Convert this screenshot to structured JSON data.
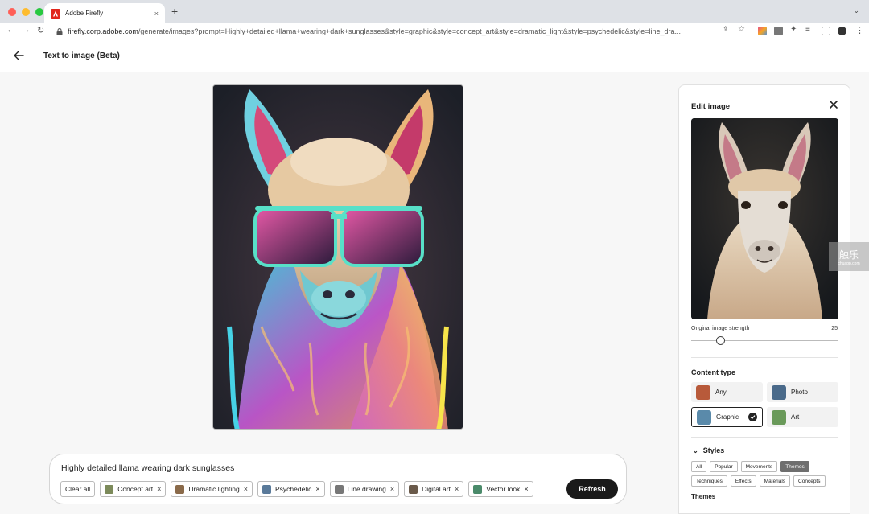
{
  "browser": {
    "tab_title": "Adobe Firefly",
    "url_host": "firefly.corp.adobe.com",
    "url_path": "/generate/images?prompt=Highly+detailed+llama+wearing+dark+sunglasses&style=graphic&style=concept_art&style=dramatic_light&style=psychedelic&style=line_dra...",
    "new_tab_label": "+",
    "close_tab_label": "×"
  },
  "header": {
    "title": "Text to image (Beta)"
  },
  "prompt": {
    "text": "Highly detailed llama wearing dark sunglasses",
    "clear_all": "Clear all",
    "chips": [
      {
        "label": "Concept art",
        "color": "#7c8a5a"
      },
      {
        "label": "Dramatic lighting",
        "color": "#8a6a4a"
      },
      {
        "label": "Psychedelic",
        "color": "#5a7a9a"
      },
      {
        "label": "Line drawing",
        "color": "#777777"
      },
      {
        "label": "Digital art",
        "color": "#6a5a4a"
      },
      {
        "label": "Vector look",
        "color": "#4a8a6a"
      }
    ],
    "refresh": "Refresh"
  },
  "panel": {
    "title": "Edit image",
    "strength_label": "Original image strength",
    "strength_value": "25",
    "strength_fraction": 0.2,
    "content_type_title": "Content type",
    "content_types": [
      {
        "label": "Any",
        "selected": false,
        "color": "#b85a3a"
      },
      {
        "label": "Photo",
        "selected": false,
        "color": "#4a6a8a"
      },
      {
        "label": "Graphic",
        "selected": true,
        "color": "#5a8aaa"
      },
      {
        "label": "Art",
        "selected": false,
        "color": "#6a9a5a"
      }
    ],
    "styles_title": "Styles",
    "style_tags_row1": [
      {
        "label": "All",
        "active": false
      },
      {
        "label": "Popular",
        "active": false
      },
      {
        "label": "Movements",
        "active": false
      },
      {
        "label": "Themes",
        "active": true
      }
    ],
    "style_tags_row2": [
      {
        "label": "Techniques",
        "active": false
      },
      {
        "label": "Effects",
        "active": false
      },
      {
        "label": "Materials",
        "active": false
      },
      {
        "label": "Concepts",
        "active": false
      }
    ],
    "themes_label": "Themes"
  },
  "watermark": {
    "big": "触乐",
    "small": "chuapp.com"
  },
  "colors": {
    "accent_dark": "#1a1a1a",
    "adobe_red": "#e1251b"
  }
}
